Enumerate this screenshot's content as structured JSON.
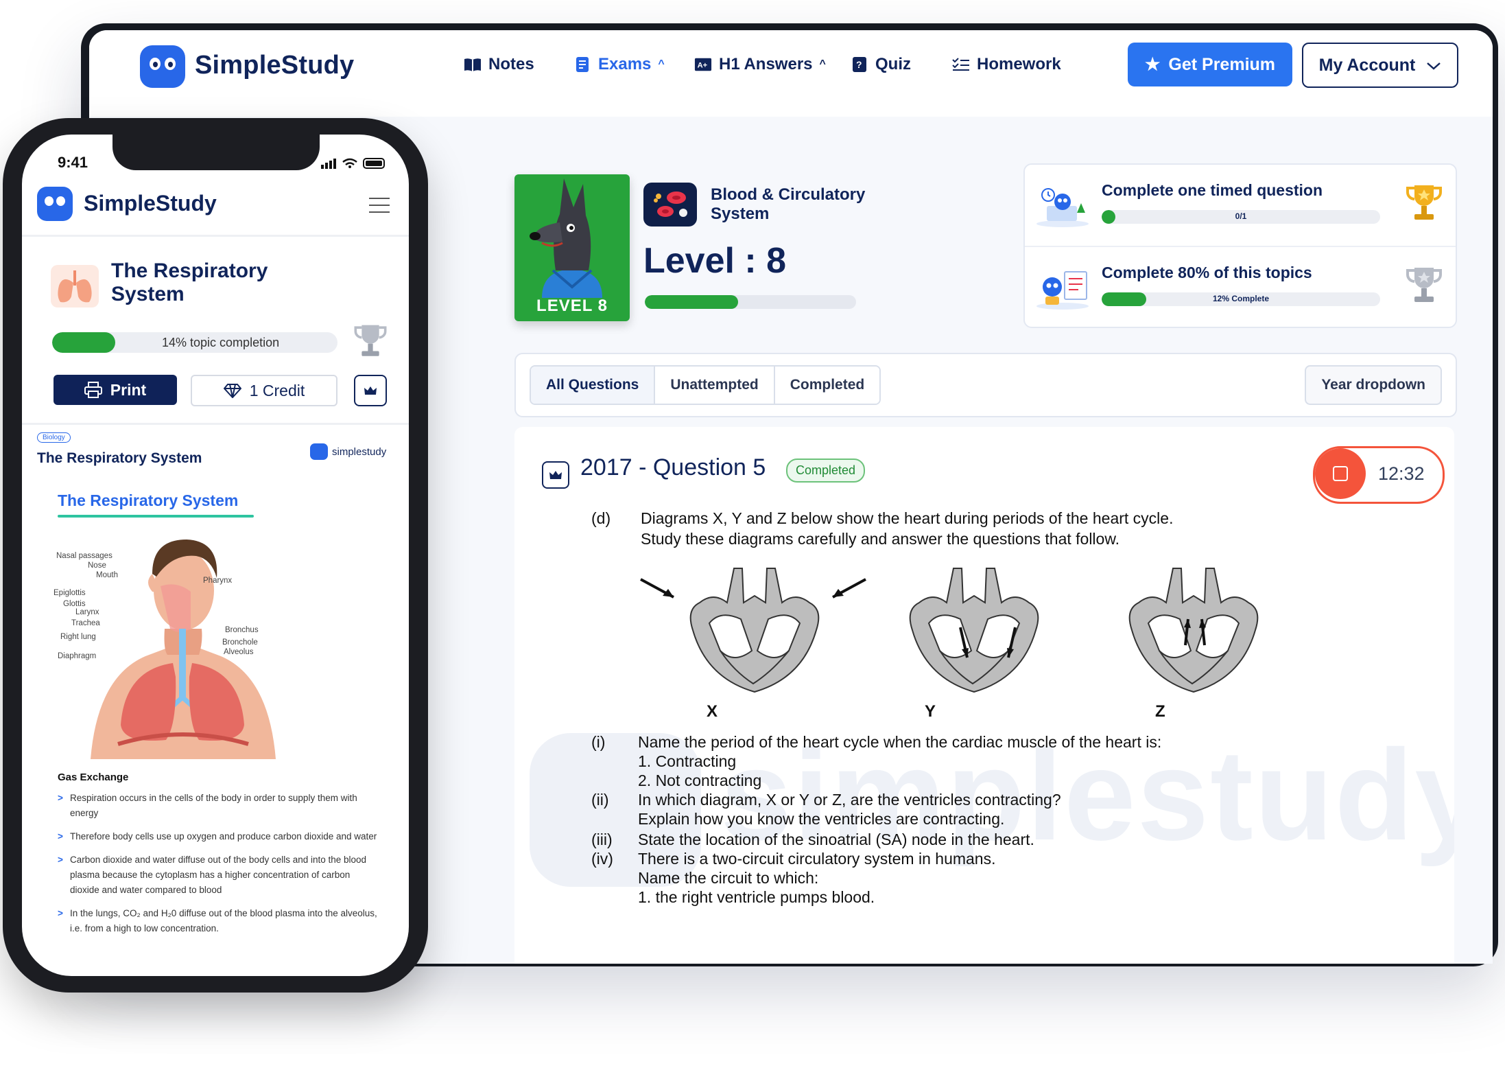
{
  "desktop": {
    "brand": "SimpleStudy",
    "nav": [
      {
        "label": "Notes",
        "icon": "book-icon"
      },
      {
        "label": "Exams",
        "icon": "exam-icon"
      },
      {
        "label": "H1 Answers",
        "icon": "answers-icon"
      },
      {
        "label": "Quiz",
        "icon": "quiz-icon"
      },
      {
        "label": "Homework",
        "icon": "homework-icon"
      }
    ],
    "premium_label": "Get Premium",
    "account_label": "My Account",
    "topic": {
      "title": "Blood & Circulatory System",
      "level_badge": "LEVEL 8",
      "level_text": "Level : 8",
      "level_progress": 0.44
    },
    "challenges": [
      {
        "title": "Complete one timed question",
        "progress_text": "0/1",
        "progress": 0.05
      },
      {
        "title": "Complete 80% of this topics",
        "progress_text": "12% Complete",
        "progress": 0.16
      }
    ],
    "filters": {
      "tabs": [
        "All Questions",
        "Unattempted",
        "Completed"
      ],
      "year_dropdown": "Year dropdown"
    },
    "question": {
      "title": "2017 - Question 5",
      "status": "Completed",
      "timer": "12:32",
      "part": "(d)",
      "intro_line1": "Diagrams X, Y and Z below show the heart during periods of the heart cycle.",
      "intro_line2": "Study these diagrams carefully and answer the questions that follow.",
      "diagram_labels": [
        "X",
        "Y",
        "Z"
      ],
      "items": [
        {
          "num": "(i)",
          "text": "Name the period of the heart cycle when the cardiac muscle of the heart is:"
        },
        {
          "num": "",
          "text": "1.      Contracting"
        },
        {
          "num": "",
          "text": "2.      Not contracting"
        },
        {
          "num": "(ii)",
          "text": "In which diagram, X or Y or Z, are the ventricles contracting?"
        },
        {
          "num": "",
          "text": "Explain how you know the ventricles are contracting."
        },
        {
          "num": "(iii)",
          "text": "State the location of the sinoatrial (SA) node in the heart."
        },
        {
          "num": "(iv)",
          "text": "There is a two-circuit circulatory system in humans."
        },
        {
          "num": "",
          "text": "Name the circuit to which:"
        },
        {
          "num": "",
          "text": "1.      the right ventricle pumps blood."
        }
      ],
      "watermark": "simplestudy"
    }
  },
  "phone": {
    "time": "9:41",
    "brand": "SimpleStudy",
    "topic_title": "The Respiratory System",
    "completion_text": "14% topic completion",
    "completion": 0.14,
    "print_label": "Print",
    "credit_label": "1 Credit",
    "doc": {
      "subject": "Biology",
      "title": "The Respiratory System",
      "brand": "simplestudy",
      "heading": "The Respiratory System",
      "labels_left": [
        "Nasal passages",
        "Nose",
        "Mouth",
        "Epiglottis",
        "Glottis",
        "Larynx",
        "Trachea",
        "Right lung",
        "Diaphragm"
      ],
      "labels_right": [
        "Pharynx",
        "Bronchus",
        "Bronchole",
        "Alveolus"
      ],
      "section": "Gas Exchange",
      "bullets": [
        "Respiration occurs in the cells of the body in order to supply them with energy",
        "Therefore body cells use up oxygen and produce carbon dioxide and water",
        "Carbon dioxide and water diffuse out of the body cells and into the blood plasma because the cytoplasm has a higher concentration of carbon dioxide and water compared to blood",
        "In the lungs, CO₂ and H₂0 diffuse out of the blood plasma into the alveolus, i.e. from a high to low concentration."
      ]
    }
  }
}
